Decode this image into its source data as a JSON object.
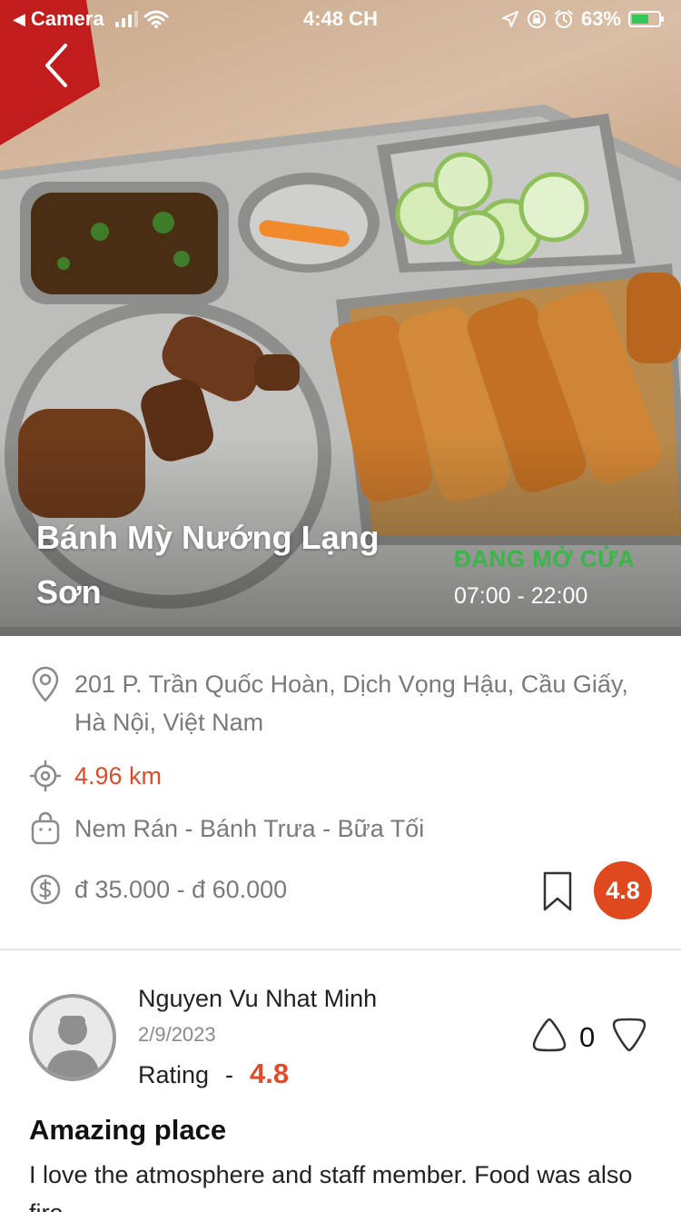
{
  "status_bar": {
    "carrier": "Camera",
    "time": "4:48 CH",
    "battery": "63%",
    "battery_level": 0.63
  },
  "hero": {
    "title": "Bánh Mỳ Nướng Lạng Sơn",
    "open_status": "ĐANG MỞ CỬA",
    "hours": "07:00 - 22:00"
  },
  "info": {
    "address": "201 P. Trần Quốc Hoàn, Dịch Vọng Hậu, Cầu Giấy, Hà Nội, Việt Nam",
    "distance": "4.96 km",
    "categories": "Nem Rán - Bánh Trưa - Bữa Tối",
    "price_range": "đ 35.000 - đ 60.000",
    "rating": "4.8"
  },
  "colors": {
    "accent": "#e04b2a",
    "open": "#39b54a"
  },
  "icons": {
    "location": "location-pin-icon",
    "distance": "crosshair-icon",
    "category": "bag-icon",
    "price": "dollar-icon",
    "bookmark": "bookmark-icon",
    "vote_up": "arrow-up-icon",
    "vote_down": "arrow-down-icon"
  },
  "review": {
    "author": "Nguyen Vu Nhat Minh",
    "date": "2/9/2023",
    "rating_label": "Rating",
    "rating_separator": "-",
    "rating_value": "4.8",
    "votes": "0",
    "title": "Amazing place",
    "body": "I love the atmosphere and staff member. Food was also fire"
  }
}
